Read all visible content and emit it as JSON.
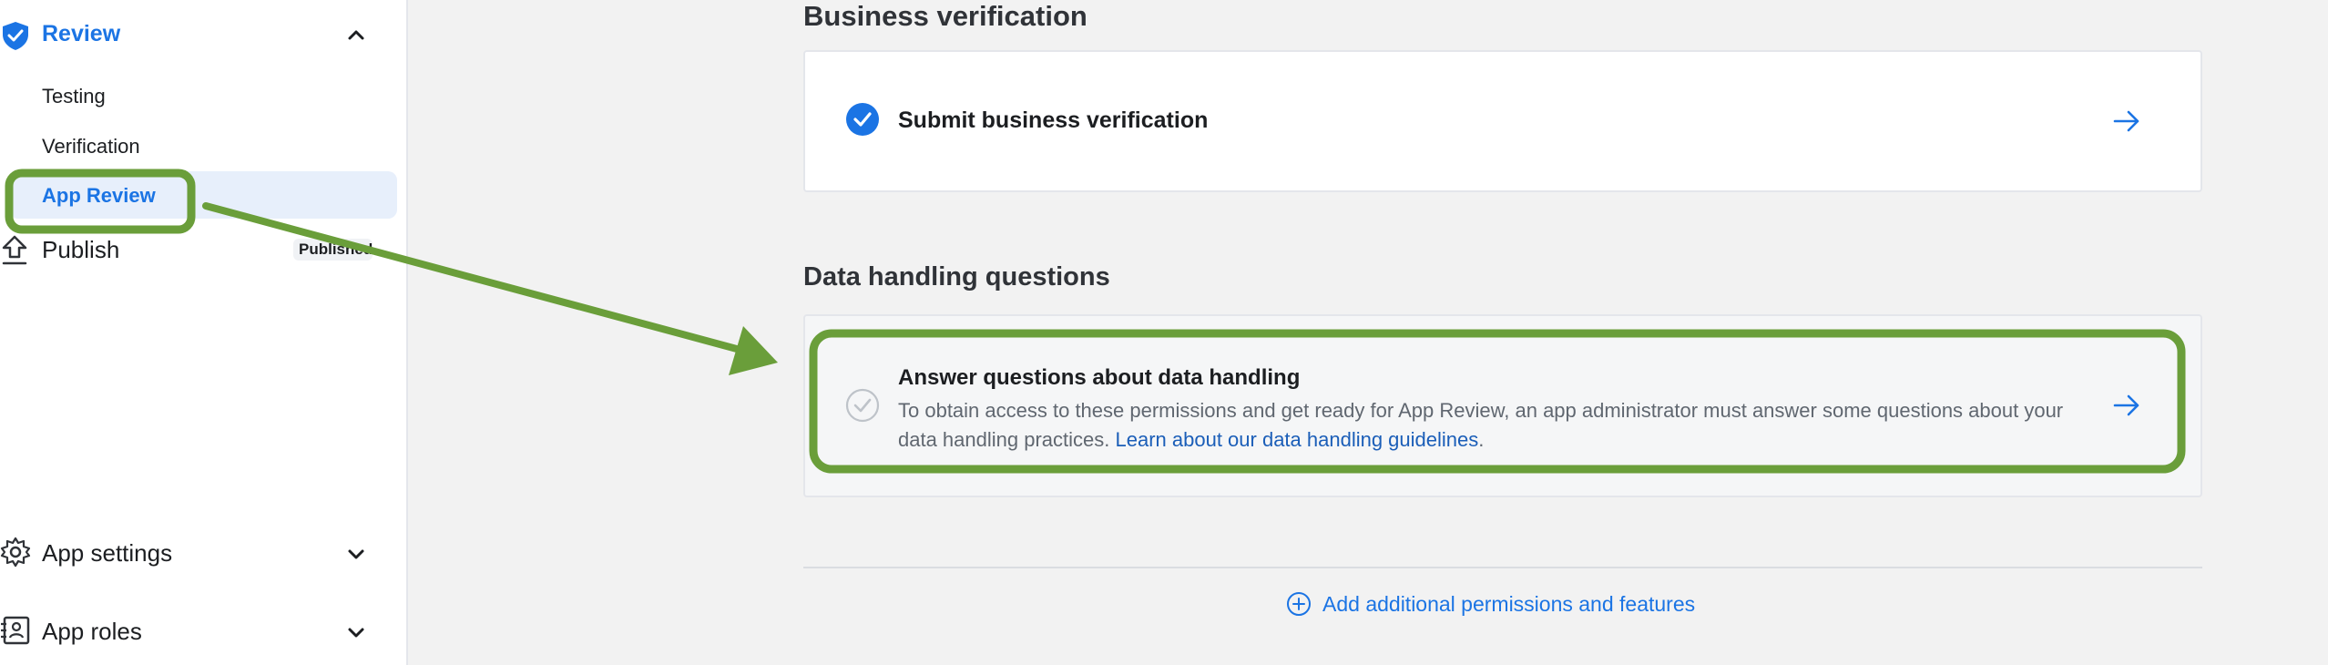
{
  "sidebar": {
    "review": {
      "label": "Review"
    },
    "sub_items": [
      "Testing",
      "Verification",
      "App Review"
    ],
    "publish": {
      "label": "Publish",
      "badge": "Published"
    },
    "app_settings": {
      "label": "App settings"
    },
    "app_roles": {
      "label": "App roles"
    }
  },
  "main": {
    "business_verification": {
      "heading": "Business verification",
      "card_title": "Submit business verification"
    },
    "data_handling": {
      "heading": "Data handling questions",
      "card_title": "Answer questions about data handling",
      "card_desc": "To obtain access to these permissions and get ready for App Review, an app administrator must answer some questions about your data handling practices.",
      "link_text": "Learn about our data handling guidelines",
      "link_suffix": "."
    },
    "add_link": "Add additional permissions and features"
  },
  "colors": {
    "accent": "#1b74e4",
    "annotation": "#6a9e3a"
  },
  "icons": {
    "review": "shield-check-icon",
    "publish": "upload-icon",
    "app_settings": "gear-icon",
    "app_roles": "id-badge-icon"
  }
}
